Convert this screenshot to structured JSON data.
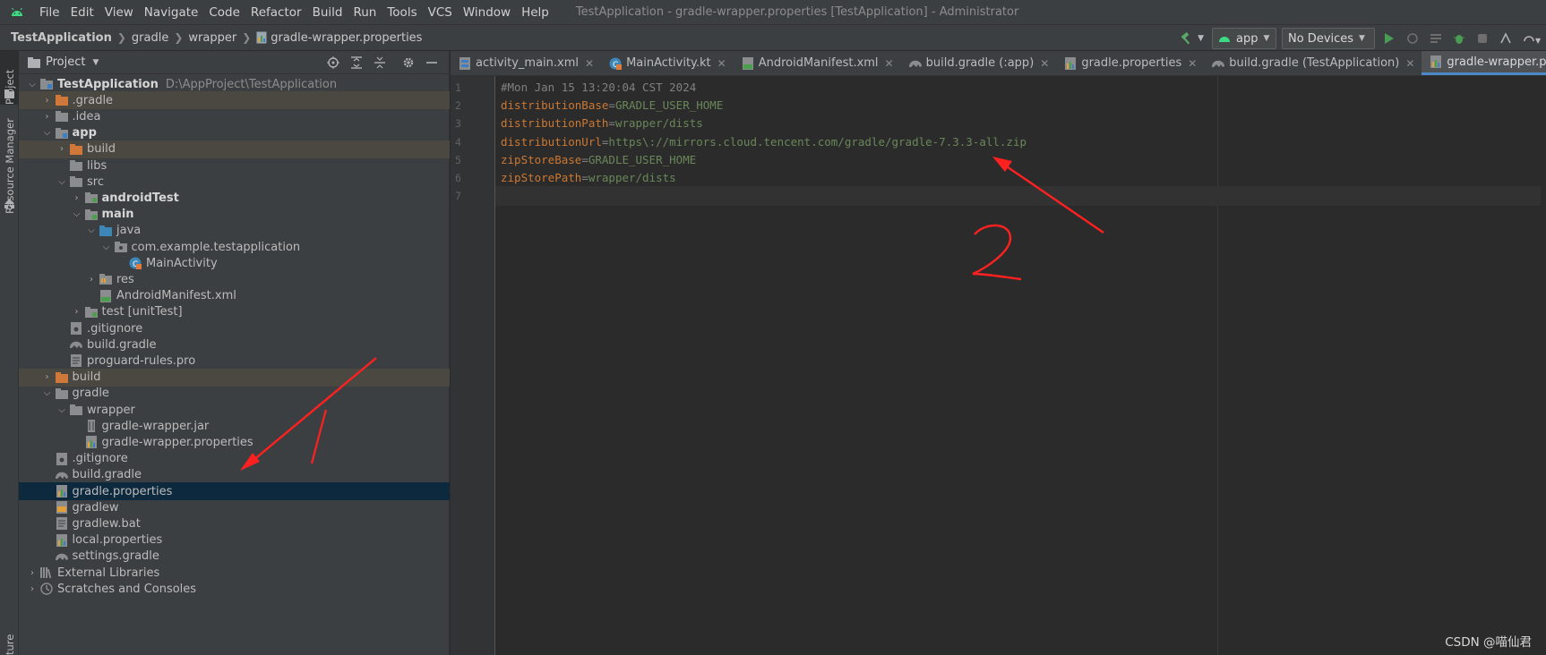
{
  "menubar": {
    "items": [
      "File",
      "Edit",
      "View",
      "Navigate",
      "Code",
      "Refactor",
      "Build",
      "Run",
      "Tools",
      "VCS",
      "Window",
      "Help"
    ],
    "window_title": "TestApplication - gradle-wrapper.properties [TestApplication] - Administrator"
  },
  "breadcrumb": [
    "TestApplication",
    "gradle",
    "wrapper",
    "gradle-wrapper.properties"
  ],
  "toolbar": {
    "run_config": "app",
    "device": "No Devices"
  },
  "left_strip": {
    "project_tab": "Project",
    "resource_manager_tab": "Resource Manager",
    "structure_tab": "ture"
  },
  "project_panel": {
    "title": "Project",
    "tree": [
      {
        "label": "TestApplication",
        "path": "D:\\AppProject\\TestApplication",
        "depth": 0,
        "open": true,
        "icon": "module-folder-icon",
        "bold": true
      },
      {
        "label": ".gradle",
        "depth": 1,
        "open": false,
        "icon": "excluded-folder-icon",
        "excluded": true
      },
      {
        "label": ".idea",
        "depth": 1,
        "open": false,
        "icon": "folder-icon"
      },
      {
        "label": "app",
        "depth": 1,
        "open": true,
        "icon": "module-folder-icon",
        "bold": true
      },
      {
        "label": "build",
        "depth": 2,
        "open": false,
        "icon": "excluded-folder-icon",
        "excluded": true
      },
      {
        "label": "libs",
        "depth": 2,
        "icon": "folder-icon"
      },
      {
        "label": "src",
        "depth": 2,
        "open": true,
        "icon": "folder-icon"
      },
      {
        "label": "androidTest",
        "depth": 3,
        "open": false,
        "icon": "test-folder-icon",
        "bold": true
      },
      {
        "label": "main",
        "depth": 3,
        "open": true,
        "icon": "source-folder-icon",
        "bold": true
      },
      {
        "label": "java",
        "depth": 4,
        "open": true,
        "icon": "java-source-folder-icon"
      },
      {
        "label": "com.example.testapplication",
        "depth": 5,
        "open": true,
        "icon": "package-icon"
      },
      {
        "label": "MainActivity",
        "depth": 6,
        "icon": "kotlin-class-icon"
      },
      {
        "label": "res",
        "depth": 4,
        "open": false,
        "icon": "resource-folder-icon"
      },
      {
        "label": "AndroidManifest.xml",
        "depth": 4,
        "icon": "manifest-file-icon"
      },
      {
        "label": "test [unitTest]",
        "depth": 3,
        "open": false,
        "icon": "test-folder-icon"
      },
      {
        "label": ".gitignore",
        "depth": 2,
        "icon": "gitignore-file-icon"
      },
      {
        "label": "build.gradle",
        "depth": 2,
        "icon": "gradle-file-icon"
      },
      {
        "label": "proguard-rules.pro",
        "depth": 2,
        "icon": "text-file-icon"
      },
      {
        "label": "build",
        "depth": 1,
        "open": false,
        "icon": "excluded-folder-icon",
        "excluded": true
      },
      {
        "label": "gradle",
        "depth": 1,
        "open": true,
        "icon": "folder-icon"
      },
      {
        "label": "wrapper",
        "depth": 2,
        "open": true,
        "icon": "folder-icon"
      },
      {
        "label": "gradle-wrapper.jar",
        "depth": 3,
        "icon": "jar-file-icon"
      },
      {
        "label": "gradle-wrapper.properties",
        "depth": 3,
        "icon": "properties-file-icon"
      },
      {
        "label": ".gitignore",
        "depth": 1,
        "icon": "gitignore-file-icon"
      },
      {
        "label": "build.gradle",
        "depth": 1,
        "icon": "gradle-file-icon"
      },
      {
        "label": "gradle.properties",
        "depth": 1,
        "icon": "properties-file-icon",
        "selected": true
      },
      {
        "label": "gradlew",
        "depth": 1,
        "icon": "shell-file-icon"
      },
      {
        "label": "gradlew.bat",
        "depth": 1,
        "icon": "text-file-icon"
      },
      {
        "label": "local.properties",
        "depth": 1,
        "icon": "properties-file-icon"
      },
      {
        "label": "settings.gradle",
        "depth": 1,
        "icon": "gradle-file-icon"
      },
      {
        "label": "External Libraries",
        "depth": 0,
        "open": false,
        "icon": "libraries-icon"
      },
      {
        "label": "Scratches and Consoles",
        "depth": 0,
        "open": false,
        "icon": "scratches-icon"
      }
    ]
  },
  "editor_tabs": [
    {
      "label": "activity_main.xml",
      "icon": "layout-file-icon"
    },
    {
      "label": "MainActivity.kt",
      "icon": "kotlin-class-icon"
    },
    {
      "label": "AndroidManifest.xml",
      "icon": "manifest-file-icon"
    },
    {
      "label": "build.gradle (:app)",
      "icon": "gradle-file-icon"
    },
    {
      "label": "gradle.properties",
      "icon": "properties-file-icon"
    },
    {
      "label": "build.gradle (TestApplication)",
      "icon": "gradle-file-icon"
    },
    {
      "label": "gradle-wrapper.properties",
      "icon": "properties-file-icon",
      "active": true
    }
  ],
  "editor": {
    "lines": [
      {
        "n": "1",
        "comment": "#Mon Jan 15 13:20:04 CST 2024"
      },
      {
        "n": "2",
        "key": "distributionBase",
        "value": "GRADLE_USER_HOME"
      },
      {
        "n": "3",
        "key": "distributionPath",
        "value": "wrapper/dists"
      },
      {
        "n": "4",
        "key": "distributionUrl",
        "value": "https\\://mirrors.cloud.tencent.com/gradle/gradle-7.3.3-all.zip"
      },
      {
        "n": "5",
        "key": "zipStoreBase",
        "value": "GRADLE_USER_HOME"
      },
      {
        "n": "6",
        "key": "zipStorePath",
        "value": "wrapper/dists"
      },
      {
        "n": "7",
        "current": true
      }
    ]
  },
  "annotations": {
    "color": "#ff2020",
    "label_1": "1",
    "label_2": "2"
  },
  "watermark": "CSDN @喵仙君",
  "colors": {
    "selected_row": "#0d293e",
    "excluded_row": "#4b4741",
    "key": "#cc7832",
    "value": "#6a8759",
    "comment": "#808080"
  }
}
